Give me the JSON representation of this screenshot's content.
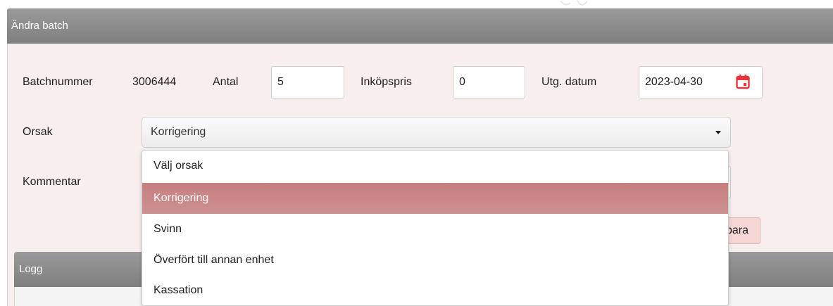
{
  "panel": {
    "title": "Ändra batch"
  },
  "form": {
    "batchnummer_label": "Batchnummer",
    "batchnummer_value": "3006444",
    "antal_label": "Antal",
    "antal_value": "5",
    "inkopspris_label": "Inköpspris",
    "inkopspris_value": "0",
    "utg_datum_label": "Utg. datum",
    "utg_datum_value": "2023-04-30",
    "orsak_label": "Orsak",
    "orsak_selected": "Korrigering",
    "kommentar_label": "Kommentar",
    "save_button_label": "Spara"
  },
  "dropdown": {
    "options": [
      {
        "label": "Välj orsak"
      },
      {
        "label": "Korrigering"
      },
      {
        "label": "Svinn"
      },
      {
        "label": "Överfört till annan enhet"
      },
      {
        "label": "Kassation"
      }
    ],
    "selected_index": 1
  },
  "log": {
    "title": "Logg"
  },
  "colors": {
    "header_bg": "#8c8c8c",
    "body_bg": "#f7eeed",
    "selected_option": "#c98586",
    "calendar_icon": "#e8343a",
    "save_button_bg": "#f5d7d5"
  },
  "icons": {
    "date_picker": "calendar-icon",
    "select_caret": "caret-down-icon"
  }
}
